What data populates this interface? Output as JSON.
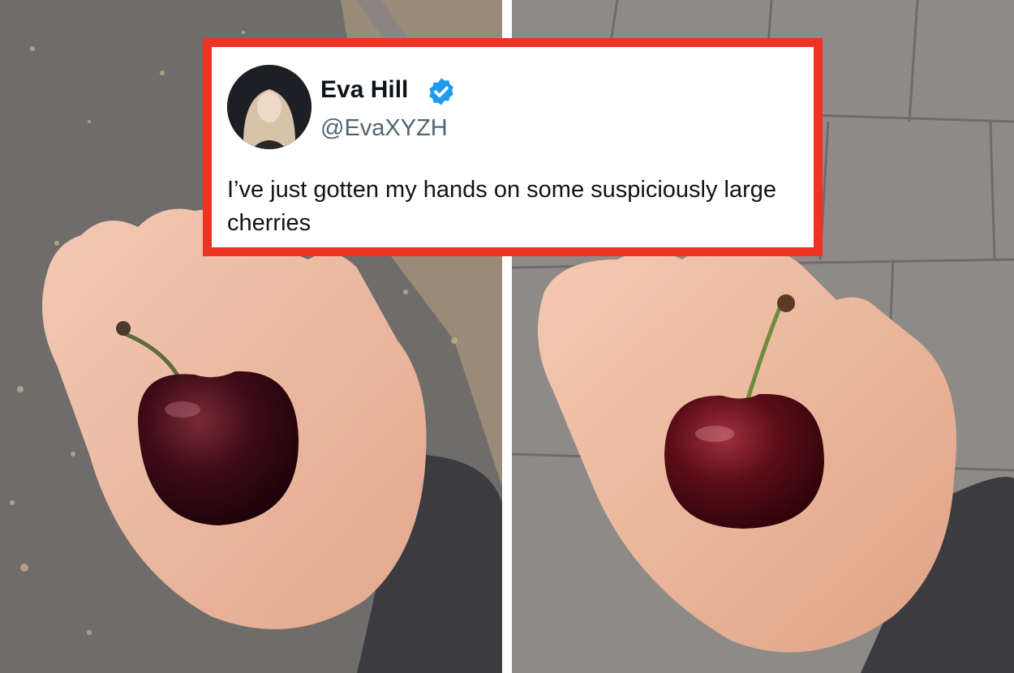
{
  "tweet": {
    "display_name": "Eva Hill",
    "handle": "@EvaXYZH",
    "verified": true,
    "text": "I’ve just gotten my hands on some suspiciously large cherries",
    "avatar_icon": "profile-photo",
    "verified_icon": "verified-badge-icon"
  },
  "photos": [
    {
      "name": "left-photo",
      "subject": "cherry-in-palm",
      "background": "asphalt-with-leaves"
    },
    {
      "name": "right-photo",
      "subject": "cherry-in-palm",
      "background": "paving-stones"
    }
  ],
  "colors": {
    "frame_border": "#ee3322",
    "verified_blue": "#1d9bf0",
    "handle_gray": "#536471",
    "text_dark": "#0f1419"
  }
}
